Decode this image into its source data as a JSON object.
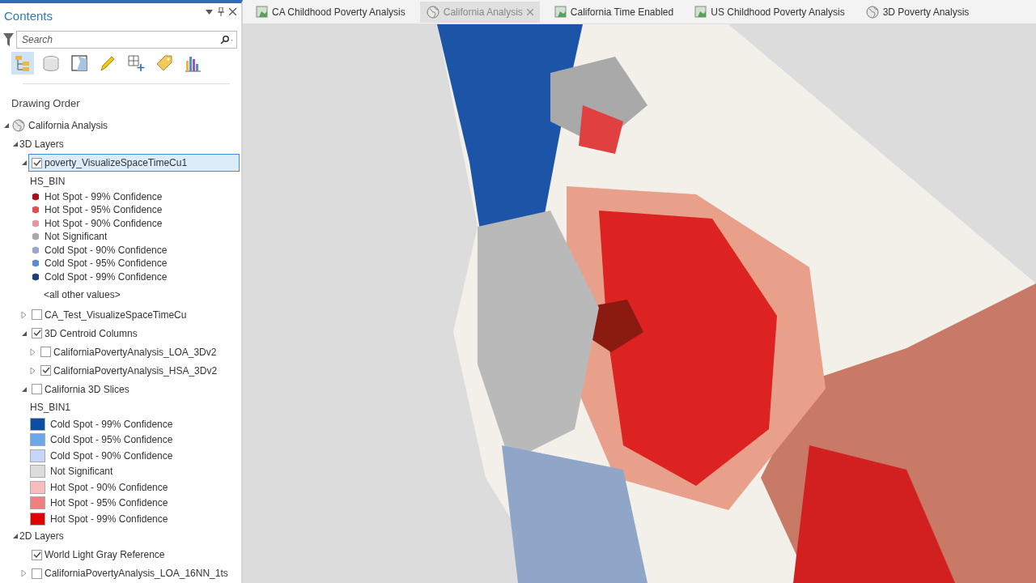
{
  "panel": {
    "title": "Contents",
    "search": {
      "placeholder": "Search"
    },
    "toolbar": [
      {
        "kind": "hierarchy",
        "selected": true
      },
      {
        "kind": "cylinder",
        "selected": false
      },
      {
        "kind": "map-square",
        "selected": false
      },
      {
        "kind": "pencil",
        "selected": false
      },
      {
        "kind": "grid-plus",
        "selected": false
      },
      {
        "kind": "tag",
        "selected": false
      },
      {
        "kind": "bar-chart",
        "selected": false
      }
    ],
    "heading": "Drawing Order",
    "tree": [
      {
        "label": "California Analysis",
        "kind": "scene",
        "expanded": true,
        "children": [
          {
            "label": "3D Layers",
            "kind": "category",
            "expanded": true,
            "children": [
              {
                "label": "poverty_VisualizeSpaceTimeCu1",
                "kind": "layer",
                "expanded": true,
                "checked": true,
                "selected": true,
                "legend": {
                  "field": "HS_BIN",
                  "kind": "cube",
                  "classes": [
                    {
                      "label": "Hot Spot - 99% Confidence",
                      "color": "#a8101a"
                    },
                    {
                      "label": "Hot Spot - 95% Confidence",
                      "color": "#d9534f"
                    },
                    {
                      "label": "Hot Spot - 90% Confidence",
                      "color": "#e09a9c"
                    },
                    {
                      "label": "Not Significant",
                      "color": "#a9a9a9"
                    },
                    {
                      "label": "Cold Spot - 90% Confidence",
                      "color": "#9aa6cc"
                    },
                    {
                      "label": "Cold Spot - 95% Confidence",
                      "color": "#5b8cc9"
                    },
                    {
                      "label": "Cold Spot - 99% Confidence",
                      "color": "#1a3f78"
                    }
                  ],
                  "other": "<all other values>"
                }
              },
              {
                "label": "CA_Test_VisualizeSpaceTimeCu",
                "kind": "layer",
                "expanded": false,
                "checked": false,
                "selected": false
              },
              {
                "label": "3D Centroid Columns",
                "kind": "layer",
                "expanded": true,
                "checked": true,
                "selected": false,
                "children": [
                  {
                    "label": "CaliforniaPovertyAnalysis_LOA_3Dv2",
                    "kind": "layer",
                    "expanded": false,
                    "checked": false,
                    "selected": false
                  },
                  {
                    "label": "CaliforniaPovertyAnalysis_HSA_3Dv2",
                    "kind": "layer",
                    "expanded": false,
                    "checked": true,
                    "selected": false
                  }
                ]
              },
              {
                "label": "California 3D Slices",
                "kind": "layer",
                "expanded": true,
                "checked": false,
                "selected": false,
                "legend": {
                  "field": "HS_BIN1",
                  "kind": "swatch",
                  "classes": [
                    {
                      "label": "Cold Spot - 99% Confidence",
                      "color": "#0b4ea2"
                    },
                    {
                      "label": "Cold Spot - 95% Confidence",
                      "color": "#6ea6ea"
                    },
                    {
                      "label": "Cold Spot - 90% Confidence",
                      "color": "#c6d6f7"
                    },
                    {
                      "label": "Not Significant",
                      "color": "#dcdcdc"
                    },
                    {
                      "label": "Hot Spot - 90% Confidence",
                      "color": "#f8bcbc"
                    },
                    {
                      "label": "Hot Spot - 95% Confidence",
                      "color": "#f08080"
                    },
                    {
                      "label": "Hot Spot - 99% Confidence",
                      "color": "#e00000"
                    }
                  ]
                }
              }
            ]
          },
          {
            "label": "2D Layers",
            "kind": "category",
            "expanded": true,
            "children": [
              {
                "label": "World Light Gray Reference",
                "kind": "layer",
                "checked": true,
                "selected": false
              },
              {
                "label": "CaliforniaPovertyAnalysis_LOA_16NN_1ts",
                "kind": "layer",
                "expanded": false,
                "checked": false,
                "selected": false
              }
            ]
          }
        ]
      }
    ]
  },
  "tabs": [
    {
      "label": "CA Childhood Poverty Analysis",
      "kind": "map",
      "selected": false
    },
    {
      "label": "California Analysis",
      "kind": "scene",
      "selected": true
    },
    {
      "label": "California Time Enabled",
      "kind": "map",
      "selected": false
    },
    {
      "label": "US Childhood Poverty Analysis",
      "kind": "map",
      "selected": false
    },
    {
      "label": "3D Poverty Analysis",
      "kind": "scene",
      "selected": false
    }
  ]
}
